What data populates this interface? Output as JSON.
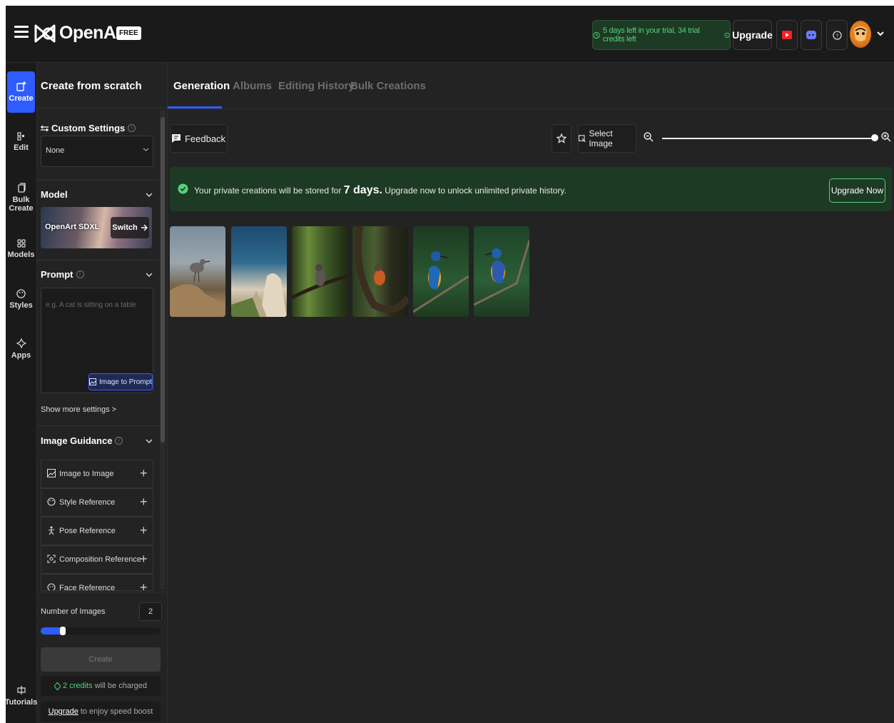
{
  "header": {
    "brand": "OpenArt",
    "badge": "FREE",
    "trial": "5 days left in your trial, 34 trial credits left",
    "upgrade": "Upgrade"
  },
  "rail": {
    "create": "Create",
    "edit": "Edit",
    "bulk_create": "Bulk Create",
    "models": "Models",
    "styles": "Styles",
    "apps": "Apps",
    "tutorials": "Tutorials"
  },
  "panel": {
    "title": "Create from scratch",
    "custom_settings": "Custom Settings",
    "custom_settings_value": "None",
    "model_label": "Model",
    "model_name": "OpenArt SDXL",
    "switch": "Switch",
    "prompt_label": "Prompt",
    "prompt_placeholder": "e.g. A cat is sitting on a table",
    "image_to_prompt": "Image to Prompt",
    "show_more": "Show more settings >",
    "guidance_label": "Image Guidance",
    "guidance_items": [
      "Image to Image",
      "Style Reference",
      "Pose Reference",
      "Composition Reference",
      "Face Reference"
    ],
    "num_images_label": "Number of Images",
    "num_images": "2",
    "num_images_fraction": 0.15,
    "create": "Create",
    "credits_amount": "2 credits",
    "credits_suffix": "will be charged",
    "boost_link": "Upgrade",
    "boost_suffix": "to enjoy speed boost"
  },
  "tabs": [
    "Generation",
    "Albums",
    "Editing History",
    "Bulk Creations"
  ],
  "toolbar": {
    "feedback": "Feedback",
    "select_image": "Select Image",
    "zoom_fraction": 1.0
  },
  "banner": {
    "prefix": "Your private creations will be stored for",
    "days": "7 days.",
    "suffix": "Upgrade now to unlock unlimited private history.",
    "upgrade_now": "Upgrade Now"
  },
  "colors": {
    "accent": "#2f5cff",
    "success": "#55d27a",
    "banner_bg": "#1d3a24",
    "bg": "#232323"
  }
}
